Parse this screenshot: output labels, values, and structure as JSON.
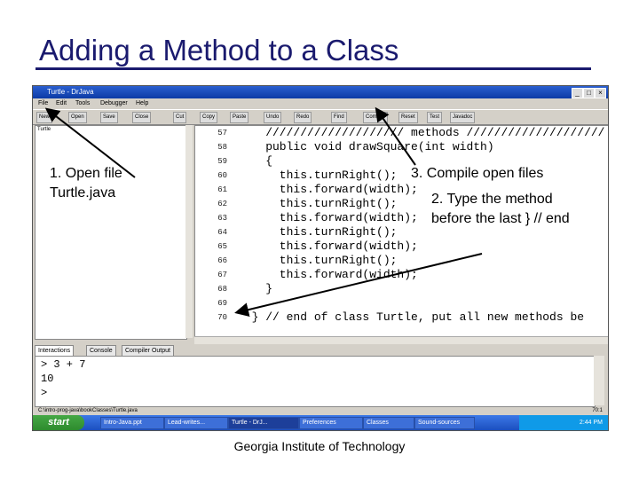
{
  "slide": {
    "title": "Adding a Method to a Class",
    "footer": "Georgia Institute of Technology"
  },
  "window": {
    "title": "Turtle - DrJava",
    "menu": [
      "File",
      "Edit",
      "Tools",
      "Debugger",
      "Help"
    ],
    "toolbar": [
      "New",
      "Open",
      "Save",
      "Close",
      "Cut",
      "Copy",
      "Paste",
      "Undo",
      "Redo",
      "Find",
      "Compile",
      "Reset",
      "Test",
      "Javadoc"
    ],
    "open_file": "Turtle",
    "code_lines": [
      {
        "num": "57",
        "text": "    //////////////////// methods ////////////////////"
      },
      {
        "num": "58",
        "text": "    public void drawSquare(int width)"
      },
      {
        "num": "59",
        "text": "    {"
      },
      {
        "num": "60",
        "text": "      this.turnRight();"
      },
      {
        "num": "61",
        "text": "      this.forward(width);"
      },
      {
        "num": "62",
        "text": "      this.turnRight();"
      },
      {
        "num": "63",
        "text": "      this.forward(width);"
      },
      {
        "num": "64",
        "text": "      this.turnRight();"
      },
      {
        "num": "65",
        "text": "      this.forward(width);"
      },
      {
        "num": "66",
        "text": "      this.turnRight();"
      },
      {
        "num": "67",
        "text": "      this.forward(width);"
      },
      {
        "num": "68",
        "text": "    }"
      },
      {
        "num": "69",
        "text": ""
      },
      {
        "num": "70",
        "text": "  } // end of class Turtle, put all new methods be"
      }
    ],
    "tabs": [
      "Interactions",
      "Console",
      "Compiler Output"
    ],
    "console_lines": [
      "> 3 + 7",
      "10",
      ">"
    ],
    "status_path": "C:\\intro-prog-java\\bookClasses\\Turtle.java",
    "status_pos": "70:1"
  },
  "taskbar": {
    "start": "start",
    "tasks": [
      "Intro-Java.ppt",
      "Lead-writes...",
      "Turtle - DrJ...",
      "Preferences",
      "Classes",
      "Sound-sources"
    ],
    "clock": "2:44 PM"
  },
  "annotations": {
    "open_file": "1.  Open file Turtle.java",
    "compile": "3.  Compile open files",
    "type_method": "2.  Type the method before the last } // end"
  },
  "colors": {
    "title": "#1a1a6e",
    "titlebar": "#0c3aa5",
    "taskbar": "#1c4fbf",
    "start": "#2e8b2e"
  }
}
